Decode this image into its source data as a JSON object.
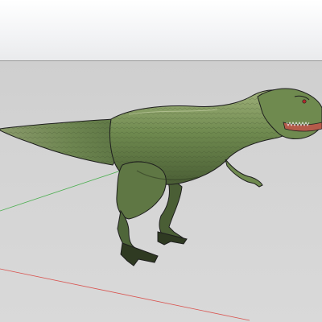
{
  "viewport": {
    "sky_color": "#f4f5f7",
    "ground_color": "#d4d4d4",
    "axis_colors": {
      "green_axis": "#4caf50",
      "red_axis": "#d9534f"
    }
  },
  "model": {
    "name_icon": "trex-model",
    "body_color": "#6f8a4f",
    "shadow_color": "#3c4a2a",
    "outline_color": "#1e1e1e"
  }
}
